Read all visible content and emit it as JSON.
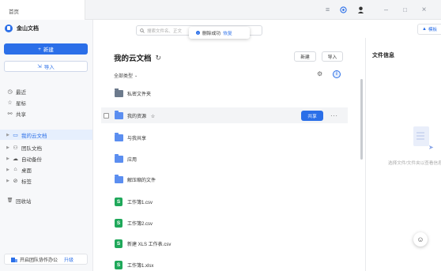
{
  "window": {
    "tab_label": "首页",
    "controls": {
      "menu_icon": "≡",
      "minimize": "–",
      "maximize": "□",
      "close": "×"
    }
  },
  "sidebar": {
    "brand": "金山文档",
    "new_label": "新建",
    "import_label": "导入",
    "items": [
      {
        "label": "最近",
        "icon": "clock-icon",
        "glyph": "◷"
      },
      {
        "label": "星标",
        "icon": "star-icon",
        "glyph": "☆"
      },
      {
        "label": "共享",
        "icon": "share-icon",
        "glyph": "⚯"
      },
      {
        "label": "我的云文档",
        "icon": "cloud-doc-icon",
        "glyph": "▭",
        "active": true
      },
      {
        "label": "团队文档",
        "icon": "team-icon",
        "glyph": "⚇"
      },
      {
        "label": "自动备份",
        "icon": "backup-icon",
        "glyph": "☁"
      },
      {
        "label": "桌面",
        "icon": "desktop-icon",
        "glyph": "⌂"
      },
      {
        "label": "标签",
        "icon": "tag-icon",
        "glyph": "⊘"
      },
      {
        "label": "回收站",
        "icon": "trash-icon",
        "glyph": "🗑"
      }
    ],
    "footer_text": "开启团队协作办公",
    "footer_link": "升级"
  },
  "search": {
    "placeholder": "搜索文件名、正文"
  },
  "toast": {
    "message": "删除成功",
    "action": "恢复"
  },
  "header_right_btn": "模板",
  "main": {
    "title": "我的云文档",
    "new_btn": "新建",
    "import_btn": "导入",
    "filter_label": "全部类型",
    "rows": [
      {
        "name": "私密文件夹",
        "type": "folder-grey"
      },
      {
        "name": "我的资源",
        "type": "folder",
        "star": "☆",
        "hover": true,
        "share_label": "共享"
      },
      {
        "name": "与我共享",
        "type": "folder"
      },
      {
        "name": "应用",
        "type": "folder"
      },
      {
        "name": "解压缩的文件",
        "type": "folder"
      },
      {
        "name": "工作簿1.csv",
        "type": "sheet",
        "glyph": "S"
      },
      {
        "name": "工作簿2.csv",
        "type": "sheet",
        "glyph": "S"
      },
      {
        "name": "新建 XLS 工作表.csv",
        "type": "sheet",
        "glyph": "S"
      },
      {
        "name": "工作簿1.xlsx",
        "type": "sheet",
        "glyph": "S"
      }
    ]
  },
  "right_panel": {
    "title": "文件信息",
    "empty_text": "选择文件/文件夹以查看信息"
  },
  "colors": {
    "accent": "#2b6fe8",
    "sheet": "#1fa85a"
  }
}
